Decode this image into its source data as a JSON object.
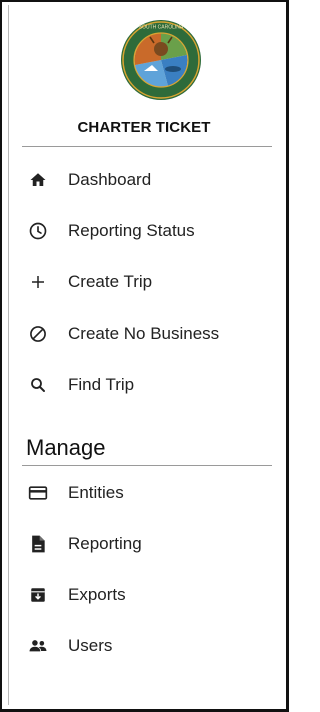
{
  "app": {
    "title": "CHARTER TICKET",
    "logo_text": "SOUTH CAROLINA DEPARTMENT OF NATURAL RESOURCES"
  },
  "nav": {
    "items": [
      {
        "label": "Dashboard",
        "icon": "home-icon"
      },
      {
        "label": "Reporting Status",
        "icon": "clock-icon"
      },
      {
        "label": "Create Trip",
        "icon": "plus-icon"
      },
      {
        "label": "Create No Business",
        "icon": "block-icon"
      },
      {
        "label": "Find Trip",
        "icon": "search-icon"
      }
    ]
  },
  "manage": {
    "heading": "Manage",
    "items": [
      {
        "label": "Entities",
        "icon": "card-icon"
      },
      {
        "label": "Reporting",
        "icon": "document-icon"
      },
      {
        "label": "Exports",
        "icon": "archive-icon"
      },
      {
        "label": "Users",
        "icon": "users-icon"
      }
    ]
  },
  "colors": {
    "logo_ring": "#2e6b3a",
    "logo_gold": "#d9a531",
    "logo_water": "#3a7fc2",
    "text": "#222222"
  }
}
